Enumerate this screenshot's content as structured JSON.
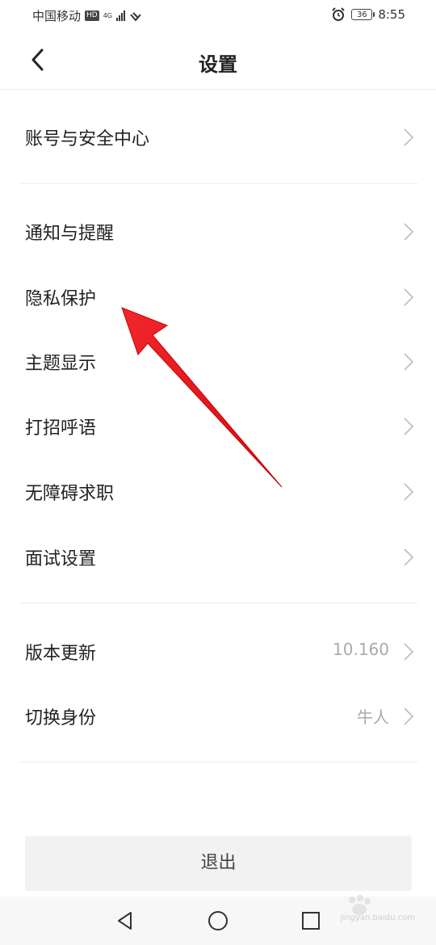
{
  "status_bar": {
    "carrier": "中国移动",
    "hd": "HD",
    "network": "4G",
    "battery": "36",
    "time": "8:55"
  },
  "header": {
    "title": "设置"
  },
  "menu": {
    "account": {
      "label": "账号与安全中心"
    },
    "notify": {
      "label": "通知与提醒"
    },
    "privacy": {
      "label": "隐私保护"
    },
    "theme": {
      "label": "主题显示"
    },
    "greeting": {
      "label": "打招呼语"
    },
    "accessible": {
      "label": "无障碍求职"
    },
    "interview": {
      "label": "面试设置"
    },
    "version": {
      "label": "版本更新",
      "value": "10.160"
    },
    "identity": {
      "label": "切换身份",
      "value": "牛人"
    }
  },
  "logout": {
    "label": "退出"
  },
  "watermark": {
    "text": "jingyan.baidu.com"
  },
  "colors": {
    "background": "#ffffff",
    "text": "#222222",
    "secondary": "#aaaaaa",
    "divider": "#eeeeee",
    "arrow": "#e8151b"
  }
}
